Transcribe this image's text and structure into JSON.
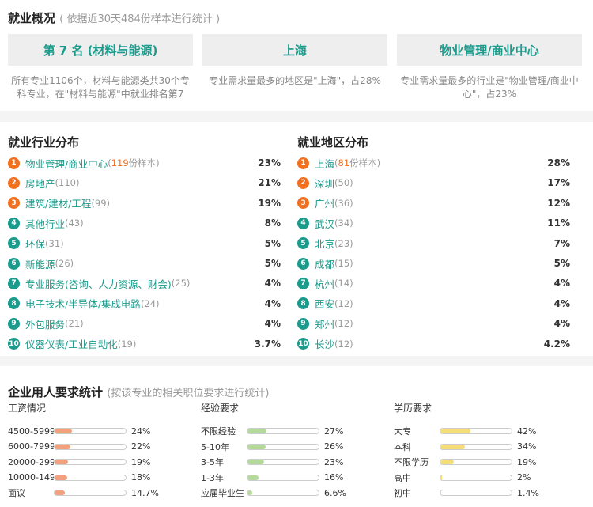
{
  "overview": {
    "title": "就业概况",
    "note": "( 依据近30天484份样本进行统计 )",
    "boxes": [
      {
        "value": "第 7 名 (材料与能源)",
        "desc": "所有专业1106个，材料与能源类共30个专科专业，在\"材料与能源\"中就业排名第7"
      },
      {
        "value": "上海",
        "desc": "专业需求量最多的地区是\"上海\"，占28%"
      },
      {
        "value": "物业管理/商业中心",
        "desc": "专业需求量最多的行业是\"物业管理/商业中心\"，占23%"
      }
    ]
  },
  "industry": {
    "title": "就业行业分布",
    "items": [
      {
        "rank": "1",
        "name": "物业管理/商业中心",
        "count": "119",
        "count_suffix": "份样本",
        "pct": "23%"
      },
      {
        "rank": "2",
        "name": "房地产",
        "count": "(110)",
        "pct": "21%"
      },
      {
        "rank": "3",
        "name": "建筑/建材/工程",
        "count": "(99)",
        "pct": "19%"
      },
      {
        "rank": "4",
        "name": "其他行业",
        "count": "(43)",
        "pct": "8%"
      },
      {
        "rank": "5",
        "name": "环保",
        "count": "(31)",
        "pct": "5%"
      },
      {
        "rank": "6",
        "name": "新能源",
        "count": "(26)",
        "pct": "5%"
      },
      {
        "rank": "7",
        "name": "专业服务(咨询、人力资源、财会)",
        "count": "(25)",
        "pct": "4%"
      },
      {
        "rank": "8",
        "name": "电子技术/半导体/集成电路",
        "count": "(24)",
        "pct": "4%"
      },
      {
        "rank": "9",
        "name": "外包服务",
        "count": "(21)",
        "pct": "4%"
      },
      {
        "rank": "10",
        "name": "仪器仪表/工业自动化",
        "count": "(19)",
        "pct": "3.7%"
      }
    ]
  },
  "region": {
    "title": "就业地区分布",
    "items": [
      {
        "rank": "1",
        "name": "上海",
        "count": "81",
        "count_suffix": "份样本",
        "pct": "28%"
      },
      {
        "rank": "2",
        "name": "深圳",
        "count": "(50)",
        "pct": "17%"
      },
      {
        "rank": "3",
        "name": "广州",
        "count": "(36)",
        "pct": "12%"
      },
      {
        "rank": "4",
        "name": "武汉",
        "count": "(34)",
        "pct": "11%"
      },
      {
        "rank": "5",
        "name": "北京",
        "count": "(23)",
        "pct": "7%"
      },
      {
        "rank": "6",
        "name": "成都",
        "count": "(15)",
        "pct": "5%"
      },
      {
        "rank": "7",
        "name": "杭州",
        "count": "(14)",
        "pct": "4%"
      },
      {
        "rank": "8",
        "name": "西安",
        "count": "(12)",
        "pct": "4%"
      },
      {
        "rank": "9",
        "name": "郑州",
        "count": "(12)",
        "pct": "4%"
      },
      {
        "rank": "10",
        "name": "长沙",
        "count": "(12)",
        "pct": "4.2%"
      }
    ]
  },
  "requirements": {
    "title": "企业用人要求统计",
    "note": "(按该专业的相关职位要求进行统计)",
    "groups": [
      {
        "head": "工资情况",
        "color": "#f2a07e",
        "rows": [
          {
            "label": "4500-5999",
            "pct": "24%",
            "fill": 0.24
          },
          {
            "label": "6000-7999",
            "pct": "22%",
            "fill": 0.22
          },
          {
            "label": "20000-299",
            "pct": "19%",
            "fill": 0.19
          },
          {
            "label": "10000-149",
            "pct": "18%",
            "fill": 0.18
          },
          {
            "label": "面议",
            "pct": "14.7%",
            "fill": 0.147
          }
        ]
      },
      {
        "head": "经验要求",
        "color": "#b5d99a",
        "rows": [
          {
            "label": "不限经验",
            "pct": "27%",
            "fill": 0.27
          },
          {
            "label": "5-10年",
            "pct": "26%",
            "fill": 0.26
          },
          {
            "label": "3-5年",
            "pct": "23%",
            "fill": 0.23
          },
          {
            "label": "1-3年",
            "pct": "16%",
            "fill": 0.16
          },
          {
            "label": "应届毕业生",
            "pct": "6.6%",
            "fill": 0.066
          }
        ]
      },
      {
        "head": "学历要求",
        "color": "#f5dd77",
        "rows": [
          {
            "label": "大专",
            "pct": "42%",
            "fill": 0.42
          },
          {
            "label": "本科",
            "pct": "34%",
            "fill": 0.34
          },
          {
            "label": "不限学历",
            "pct": "19%",
            "fill": 0.19
          },
          {
            "label": "高中",
            "pct": "2%",
            "fill": 0.02
          },
          {
            "label": "初中",
            "pct": "1.4%",
            "fill": 0.014
          }
        ]
      }
    ]
  }
}
